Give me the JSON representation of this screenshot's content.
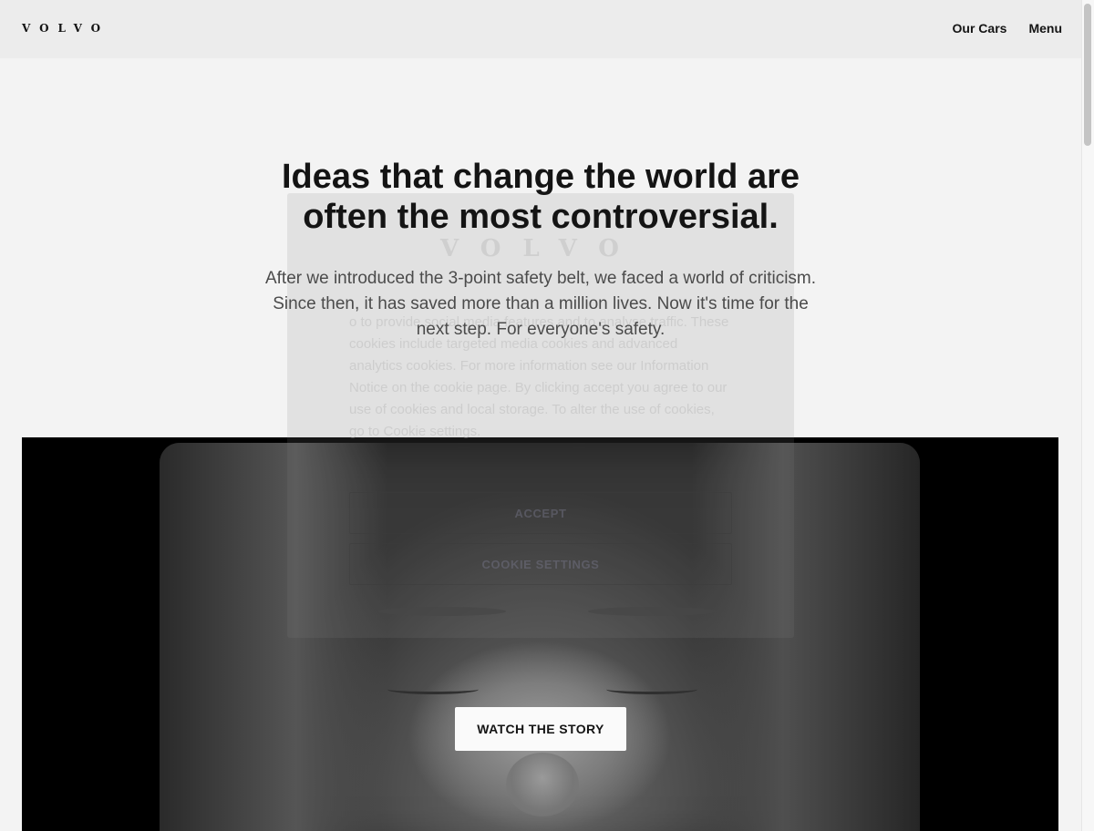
{
  "header": {
    "logo": "VOLVO",
    "nav": {
      "our_cars": "Our Cars",
      "menu": "Menu"
    }
  },
  "hero": {
    "title_line1": "Ideas that change the world are",
    "title_line2": "often the most controversial.",
    "subtitle": "After we introduced the 3-point safety belt, we faced a world of criticism. Since then, it has saved more than a million lives. Now it's time for the next step. For everyone's safety."
  },
  "video": {
    "watch_label": "WATCH THE STORY"
  },
  "cookie": {
    "logo": "VOLVO",
    "text": "o to provide social media features and to analyse traffic. These cookies include targeted media cookies and advanced analytics cookies. For more information see our Information Notice on the cookie page. By clicking accept you agree to our use of cookies and local storage. To alter the use of cookies, go to Cookie settings.",
    "accept_label": "ACCEPT",
    "settings_label": "COOKIE SETTINGS"
  },
  "colors": {
    "background": "#f3f3f3",
    "header_bg": "#ececec",
    "text_primary": "#141414",
    "text_secondary": "#4b4b4b"
  }
}
